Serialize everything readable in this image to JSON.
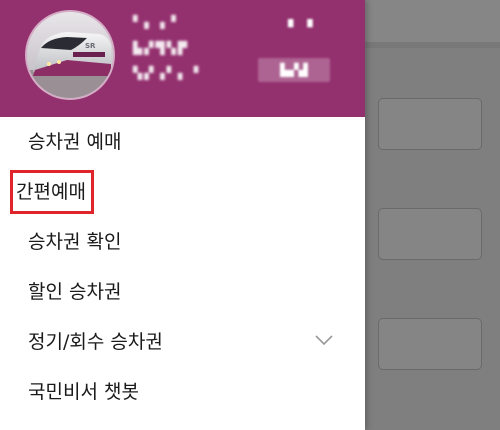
{
  "header": {
    "user_lines": [
      "▘▖▗▝",
      "▙▞▜▚▛",
      "▚▞▗▘▖▝"
    ],
    "badge_top": "▘▝",
    "badge_box": "▙▞▟"
  },
  "menu": {
    "items": [
      {
        "label": "승차권 예매",
        "highlighted": false
      },
      {
        "label": "간편예매",
        "highlighted": true
      },
      {
        "label": "승차권 확인",
        "highlighted": false
      },
      {
        "label": "할인 승차권",
        "highlighted": false
      },
      {
        "label": "정기/회수 승차권",
        "highlighted": false,
        "expandable": true
      },
      {
        "label": "국민비서 챗봇",
        "highlighted": false
      }
    ]
  },
  "colors": {
    "header_bg": "#93306e",
    "highlight_outline": "#e0242b",
    "overlay_bg": "#7f7f7f"
  },
  "icons": {
    "avatar": "train-photo",
    "expand": "chevron-down-icon"
  }
}
